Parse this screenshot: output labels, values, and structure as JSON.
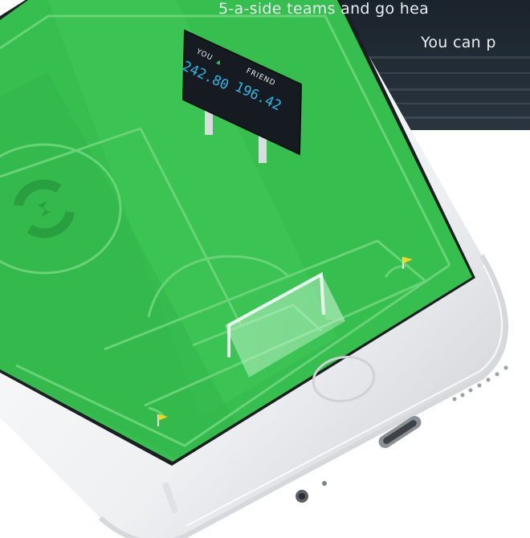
{
  "hero": {
    "line1": "5-a-side teams and go hea",
    "line2": "You can p"
  },
  "scoreboard": {
    "you_label": "YOU",
    "you_indicator": "▲",
    "you_score": "242.80",
    "friend_label": "FRIEND",
    "friend_score": "196.42"
  },
  "colors": {
    "banner_background": "#1e2730",
    "pitch_green": "#37c04f",
    "pitch_line": "#6fd67a",
    "corner_flag": "#f3d61a",
    "score_digits": "#2fb5e6",
    "indicator_green": "#35c759",
    "phone_body": "#f2f3f4"
  },
  "icons": {
    "center_logo": "refresh-circle-logo-icon",
    "flags": "corner-flag-icon"
  }
}
